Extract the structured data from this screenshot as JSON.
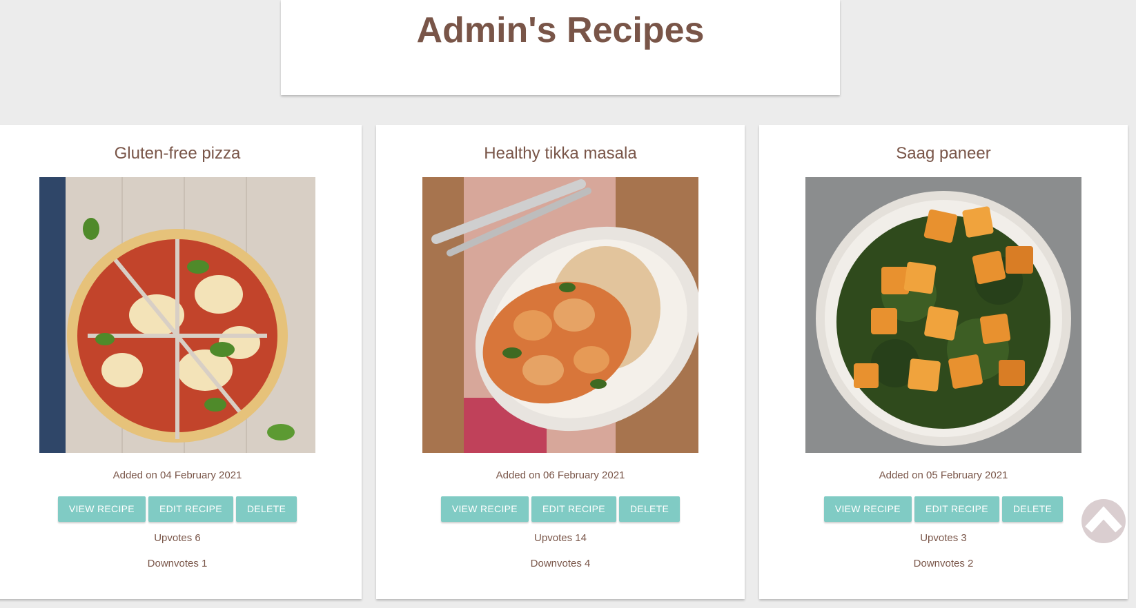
{
  "header": {
    "title": "Admin's Recipes"
  },
  "recipes": [
    {
      "title": "Gluten-free pizza",
      "added": "Added on 04 February 2021",
      "view_label": "VIEW RECIPE",
      "edit_label": "EDIT RECIPE",
      "delete_label": "DELETE",
      "upvotes": "Upvotes 6",
      "downvotes": "Downvotes 1"
    },
    {
      "title": "Healthy tikka masala",
      "added": "Added on 06 February 2021",
      "view_label": "VIEW RECIPE",
      "edit_label": "EDIT RECIPE",
      "delete_label": "DELETE",
      "upvotes": "Upvotes 14",
      "downvotes": "Downvotes 4"
    },
    {
      "title": "Saag paneer",
      "added": "Added on 05 February 2021",
      "view_label": "VIEW RECIPE",
      "edit_label": "EDIT RECIPE",
      "delete_label": "DELETE",
      "upvotes": "Upvotes 3",
      "downvotes": "Downvotes 2"
    }
  ],
  "colors": {
    "brown_text": "#795548",
    "teal_button": "#80cbc4",
    "page_background": "#ececec"
  },
  "icons": {
    "scroll_top": "chevron-up-icon"
  }
}
